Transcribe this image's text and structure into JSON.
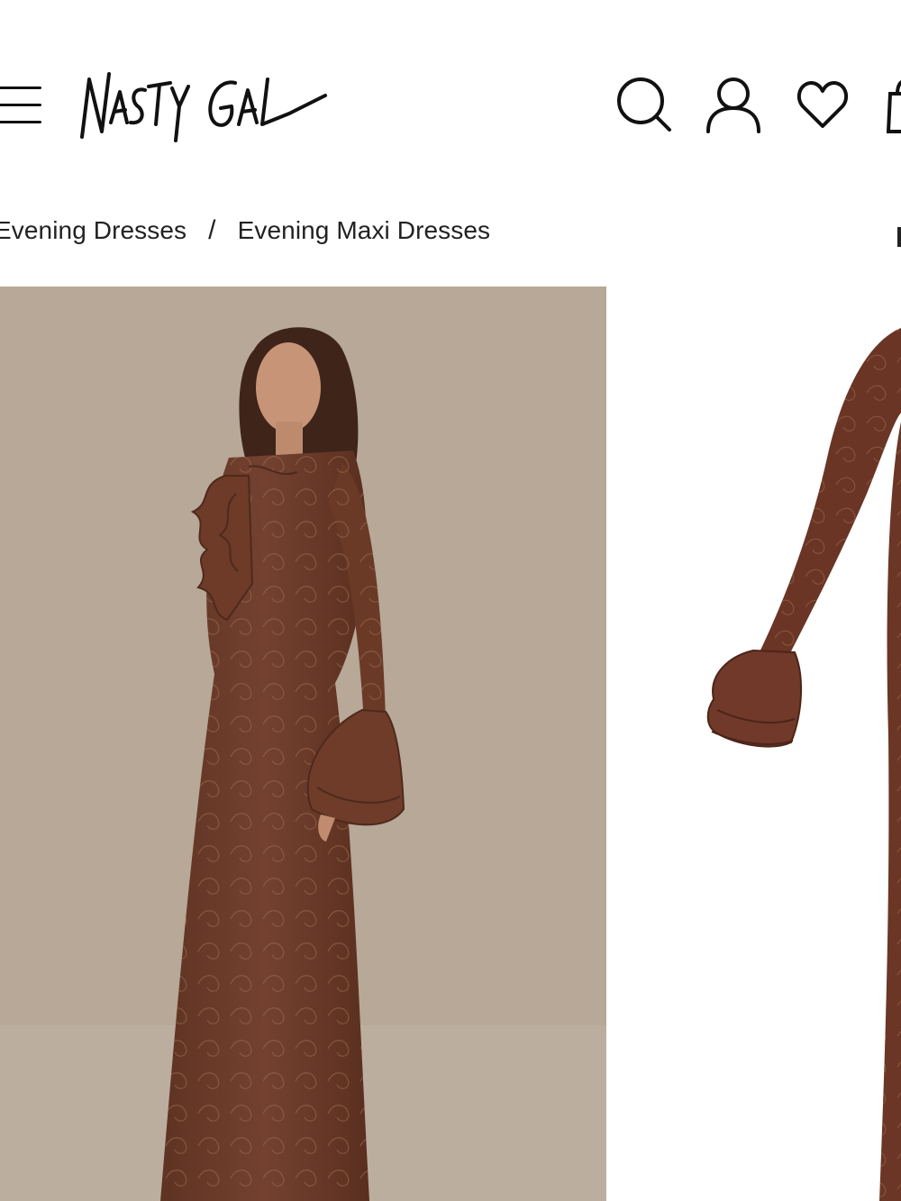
{
  "header": {
    "logo_text": "NASTY GAL",
    "menu_icon": "hamburger-menu-icon",
    "icons": [
      "search-icon",
      "account-icon",
      "heart-icon",
      "bag-icon"
    ]
  },
  "breadcrumb": {
    "items": [
      {
        "label": "Evening Dresses"
      },
      {
        "label": "Evening Maxi Dresses"
      }
    ],
    "separator": "/"
  },
  "gallery": {
    "images": [
      {
        "subject": "model-photo"
      },
      {
        "subject": "product-photo"
      }
    ]
  },
  "colors": {
    "background": "#ffffff",
    "photo_backdrop": "#b9ab9c",
    "dress_brown": "#6b3a26",
    "text": "#1a1a1a"
  }
}
